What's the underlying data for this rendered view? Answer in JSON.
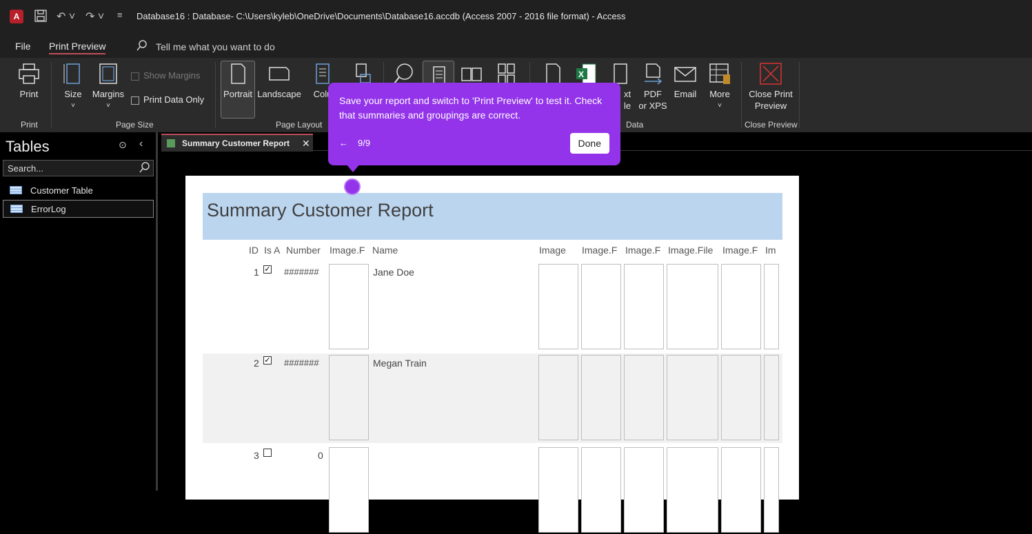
{
  "window": {
    "title": "Database16 : Database- C:\\Users\\kyleb\\OneDrive\\Documents\\Database16.accdb (Access 2007 - 2016 file format)  -  Access",
    "logo_letter": "A"
  },
  "menu": {
    "file": "File",
    "print_preview": "Print Preview",
    "tell_me": "Tell me what you want to do"
  },
  "ribbon": {
    "print": "Print",
    "size": "Size",
    "margins": "Margins",
    "show_margins": "Show Margins",
    "print_data_only": "Print Data Only",
    "portrait": "Portrait",
    "landscape": "Landscape",
    "columns": "Colu",
    "text_file_1": "xt",
    "text_file_2": "le",
    "pdf_1": "PDF",
    "pdf_2": "or XPS",
    "email": "Email",
    "more": "More",
    "close_1": "Close Print",
    "close_2": "Preview",
    "groups": {
      "print": "Print",
      "page_size": "Page Size",
      "page_layout": "Page Layout",
      "data": "Data",
      "close_preview": "Close Preview"
    }
  },
  "nav": {
    "title": "Tables",
    "search_placeholder": "Search...",
    "items": [
      "Customer Table",
      "ErrorLog"
    ]
  },
  "doc": {
    "tab": "Summary Customer Report"
  },
  "report": {
    "title": "Summary Customer Report",
    "columns": [
      "ID",
      "Is A",
      "Number",
      "Image.F",
      "Name",
      "Image",
      "Image.F",
      "Image.F",
      "Image.File",
      "Image.F",
      "Im"
    ],
    "rows": [
      {
        "id": "1",
        "checked": true,
        "number": "#######",
        "name": "Jane Doe"
      },
      {
        "id": "2",
        "checked": true,
        "number": "#######",
        "name": "Megan Train"
      },
      {
        "id": "3",
        "checked": false,
        "number": "0",
        "name": ""
      }
    ]
  },
  "tour": {
    "text": "Save your report and switch to 'Print Preview' to test it. Check that summaries and groupings are correct.",
    "step": "9/9",
    "back": "←",
    "done": "Done"
  }
}
